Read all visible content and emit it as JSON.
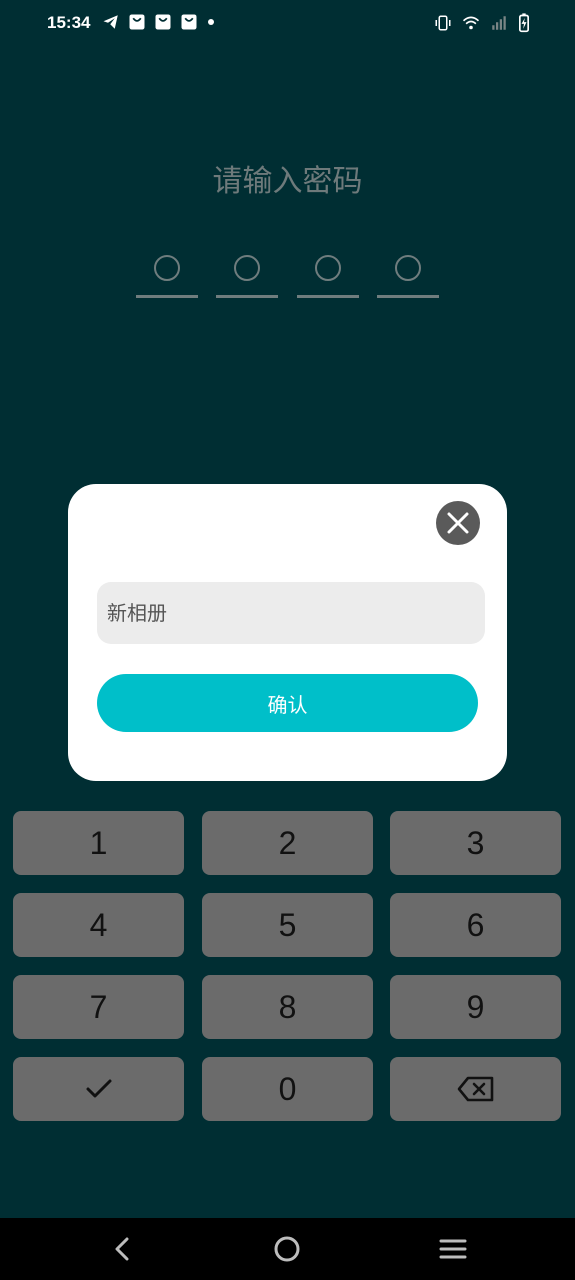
{
  "status_bar": {
    "time": "15:34",
    "left_icons": [
      "telegram-icon",
      "shopping-bag-icon",
      "shopping-bag-icon",
      "shopping-bag-icon",
      "dot-icon"
    ],
    "right_icons": [
      "vibrate-icon",
      "wifi-icon",
      "signal-icon",
      "battery-charging-icon"
    ]
  },
  "lock": {
    "prompt": "请输入密码",
    "pin_length": 4
  },
  "dialog": {
    "input_placeholder": "新相册",
    "input_value": "",
    "confirm_label": "确认"
  },
  "keypad": {
    "keys": [
      "1",
      "2",
      "3",
      "4",
      "5",
      "6",
      "7",
      "8",
      "9",
      "confirm",
      "0",
      "backspace"
    ],
    "labels": {
      "k1": "1",
      "k2": "2",
      "k3": "3",
      "k4": "4",
      "k5": "5",
      "k6": "6",
      "k7": "7",
      "k8": "8",
      "k9": "9",
      "k0": "0"
    }
  },
  "nav_bar": {
    "buttons": [
      "back-icon",
      "home-icon",
      "menu-icon"
    ]
  },
  "colors": {
    "background": "#002e33",
    "key_bg": "#6b6b6b",
    "accent": "#00bfc9",
    "muted": "#6f7d7e"
  }
}
